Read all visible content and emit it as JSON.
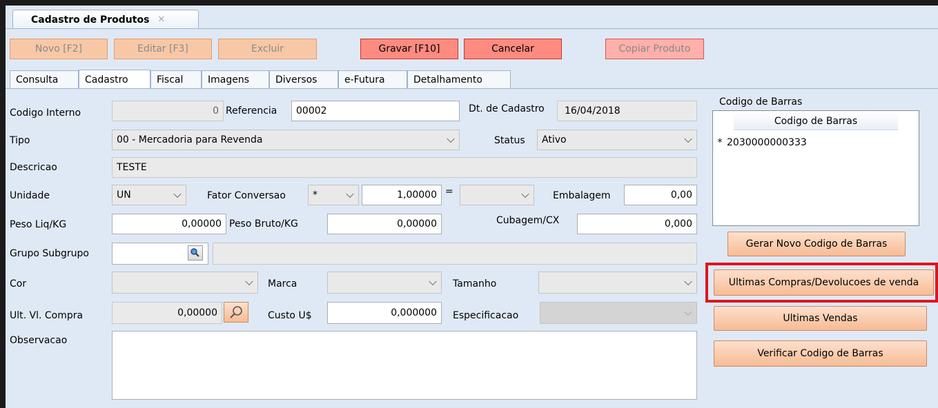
{
  "window": {
    "tab_title": "Cadastro de Produtos",
    "tab_close": "✕"
  },
  "toolbar": {
    "novo": "Novo [F2]",
    "editar": "Editar [F3]",
    "excluir": "Excluir",
    "gravar": "Gravar [F10]",
    "cancelar": "Cancelar",
    "copiar": "Copiar Produto"
  },
  "tabs": [
    "Consulta",
    "Cadastro",
    "Fiscal",
    "Imagens",
    "Diversos",
    "e-Futura",
    "Detalhamento"
  ],
  "active_tab": "Cadastro",
  "form": {
    "codigo_interno": {
      "label": "Codigo Interno",
      "value": "0"
    },
    "referencia": {
      "label": "Referencia",
      "value": "00002"
    },
    "dt_cadastro": {
      "label": "Dt. de Cadastro",
      "value": "16/04/2018"
    },
    "tipo": {
      "label": "Tipo",
      "value": "00 - Mercadoria para Revenda"
    },
    "status": {
      "label": "Status",
      "value": "Ativo"
    },
    "descricao": {
      "label": "Descricao",
      "value": "TESTE"
    },
    "unidade": {
      "label": "Unidade",
      "value": "UN"
    },
    "fator_conversao": {
      "label": "Fator Conversao",
      "operator": "*",
      "value": "1,00000",
      "equals": "=",
      "target": ""
    },
    "embalagem": {
      "label": "Embalagem",
      "value": "0,00"
    },
    "peso_liq": {
      "label": "Peso Liq/KG",
      "value": "0,00000"
    },
    "peso_bruto": {
      "label": "Peso Bruto/KG",
      "value": "0,00000"
    },
    "cubagem": {
      "label": "Cubagem/CX",
      "value": "0,000"
    },
    "grupo_subgrupo": {
      "label": "Grupo Subgrupo",
      "value": "",
      "description": ""
    },
    "cor": {
      "label": "Cor",
      "value": ""
    },
    "marca": {
      "label": "Marca",
      "value": ""
    },
    "tamanho": {
      "label": "Tamanho",
      "value": ""
    },
    "ult_vl_compra": {
      "label": "Ult. Vl. Compra",
      "value": "0,00000"
    },
    "custo_us": {
      "label": "Custo U$",
      "value": "0,000000"
    },
    "especificacao": {
      "label": "Especificacao",
      "value": ""
    },
    "observacao": {
      "label": "Observacao",
      "value": ""
    }
  },
  "barcodes": {
    "title": "Codigo de Barras",
    "column": "Codigo de Barras",
    "rows": [
      {
        "marker": "*",
        "value": "2030000000333"
      }
    ]
  },
  "side_buttons": {
    "gerar": "Gerar Novo Codigo de Barras",
    "ultimas_compras": "Ultimas Compras/Devolucoes de venda",
    "ultimas_vendas": "Ultimas Vendas",
    "verificar": "Verificar Codigo de Barras"
  },
  "colors": {
    "highlight": "#e0141e",
    "form_bg": "#dfe9f5",
    "button_orange": "#f7bb95"
  }
}
